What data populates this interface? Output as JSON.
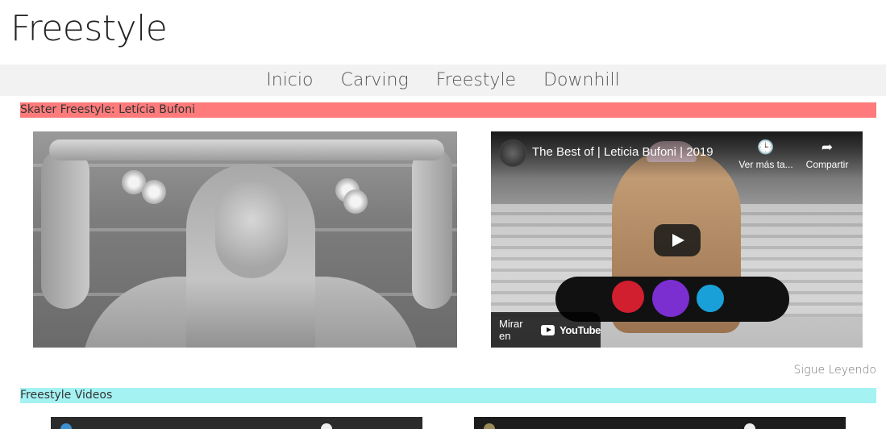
{
  "site": {
    "title": "Freestyle"
  },
  "nav": {
    "items": [
      "Inicio",
      "Carving",
      "Freestyle",
      "Downhill"
    ]
  },
  "sections": {
    "skater": {
      "heading": "Skater Freestyle: Letícia Bufoni",
      "color": "#ff7b7b"
    },
    "videos": {
      "heading": "Freestyle Videos",
      "color": "#a5f2f3"
    }
  },
  "video": {
    "title": "The Best of | Leticia Bufoni | 2019",
    "watch_later": "Ver más ta...",
    "share": "Compartir",
    "watch_on": "Mirar en",
    "youtube": "YouTube"
  },
  "read_more": "Sigue Leyendo",
  "icons": {
    "clock": "clock-icon",
    "share": "share-arrow-icon",
    "play": "play-icon",
    "youtube": "youtube-logo-icon"
  }
}
